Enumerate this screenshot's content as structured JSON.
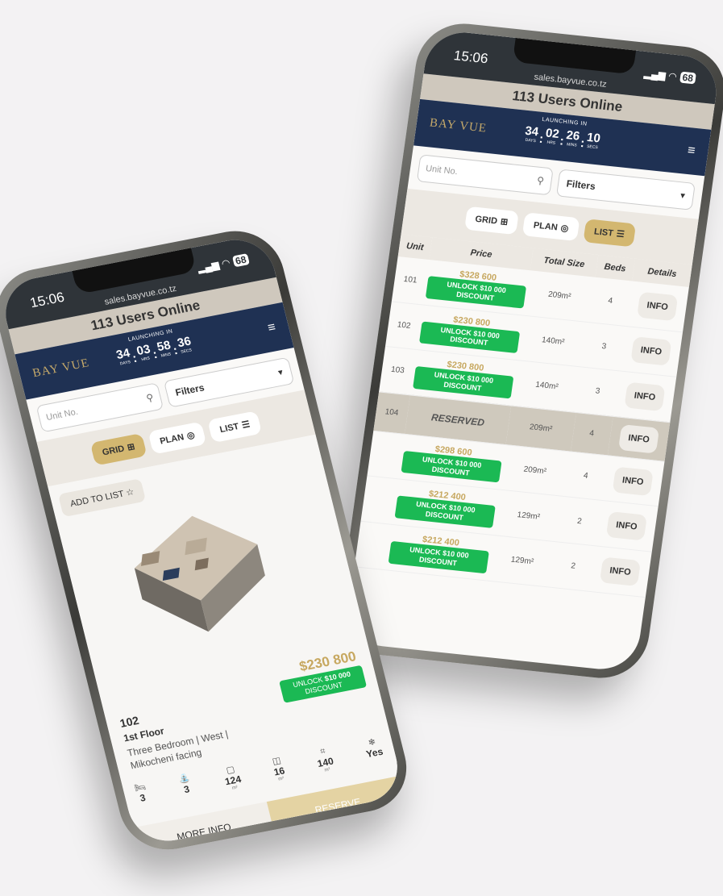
{
  "status_time": "15:06",
  "battery": "68",
  "url": "sales.bayvue.co.tz",
  "users_online": "113 Users Online",
  "logo": "BAY VUE",
  "launching_label": "LAUNCHING IN",
  "unit_labels": {
    "days": "DAYS",
    "hrs": "HRS",
    "mins": "MINS",
    "secs": "SECS"
  },
  "countdown_front": {
    "days": "34",
    "hrs": "03",
    "mins": "58",
    "secs": "36"
  },
  "countdown_back": {
    "days": "34",
    "hrs": "02",
    "mins": "26",
    "secs": "10"
  },
  "search": {
    "placeholder": "Unit No.",
    "filters_label": "Filters"
  },
  "views": {
    "grid": "GRID",
    "plan": "PLAN",
    "list": "LIST"
  },
  "card": {
    "add_to_list": "ADD TO LIST",
    "price": "$230 800",
    "unlock_prefix": "UNLOCK",
    "unlock_amount": "$10 000",
    "unlock_suffix": "DISCOUNT",
    "unit_no": "102",
    "floor": "1st Floor",
    "description": "Three Bedroom | West | Mikocheni facing",
    "stats": [
      {
        "icon": "bed-icon",
        "glyph": "🛏",
        "value": "3",
        "unit": ""
      },
      {
        "icon": "shower-icon",
        "glyph": "⛲",
        "value": "3",
        "unit": ""
      },
      {
        "icon": "interior-area-icon",
        "glyph": "▢",
        "value": "124",
        "unit": "m²"
      },
      {
        "icon": "balcony-area-icon",
        "glyph": "◫",
        "value": "16",
        "unit": "m²"
      },
      {
        "icon": "total-area-icon",
        "glyph": "⌗",
        "value": "140",
        "unit": "m²"
      },
      {
        "icon": "ac-icon",
        "glyph": "❄",
        "value": "Yes",
        "unit": ""
      }
    ],
    "more_info": "MORE INFO",
    "reserve": "RESERVE"
  },
  "list": {
    "headers": {
      "unit": "Unit",
      "price": "Price",
      "size": "Total Size",
      "beds": "Beds",
      "details": "Details"
    },
    "rows": [
      {
        "unit": "101",
        "price": "$328 600",
        "size": "209m²",
        "beds": "4",
        "status": "available"
      },
      {
        "unit": "102",
        "price": "$230 800",
        "size": "140m²",
        "beds": "3",
        "status": "available"
      },
      {
        "unit": "103",
        "price": "$230 800",
        "size": "140m²",
        "beds": "3",
        "status": "available"
      },
      {
        "unit": "104",
        "price": "RESERVED",
        "size": "209m²",
        "beds": "4",
        "status": "reserved"
      },
      {
        "unit": "",
        "price": "$298 600",
        "size": "209m²",
        "beds": "4",
        "status": "available"
      },
      {
        "unit": "",
        "price": "$212 400",
        "size": "129m²",
        "beds": "2",
        "status": "available"
      },
      {
        "unit": "",
        "price": "$212 400",
        "size": "129m²",
        "beds": "2",
        "status": "available"
      }
    ],
    "info_label": "INFO"
  },
  "colors": {
    "navy": "#1f3153",
    "gold": "#c7a860",
    "green": "#1bb954",
    "beige": "#cfc8bd"
  }
}
